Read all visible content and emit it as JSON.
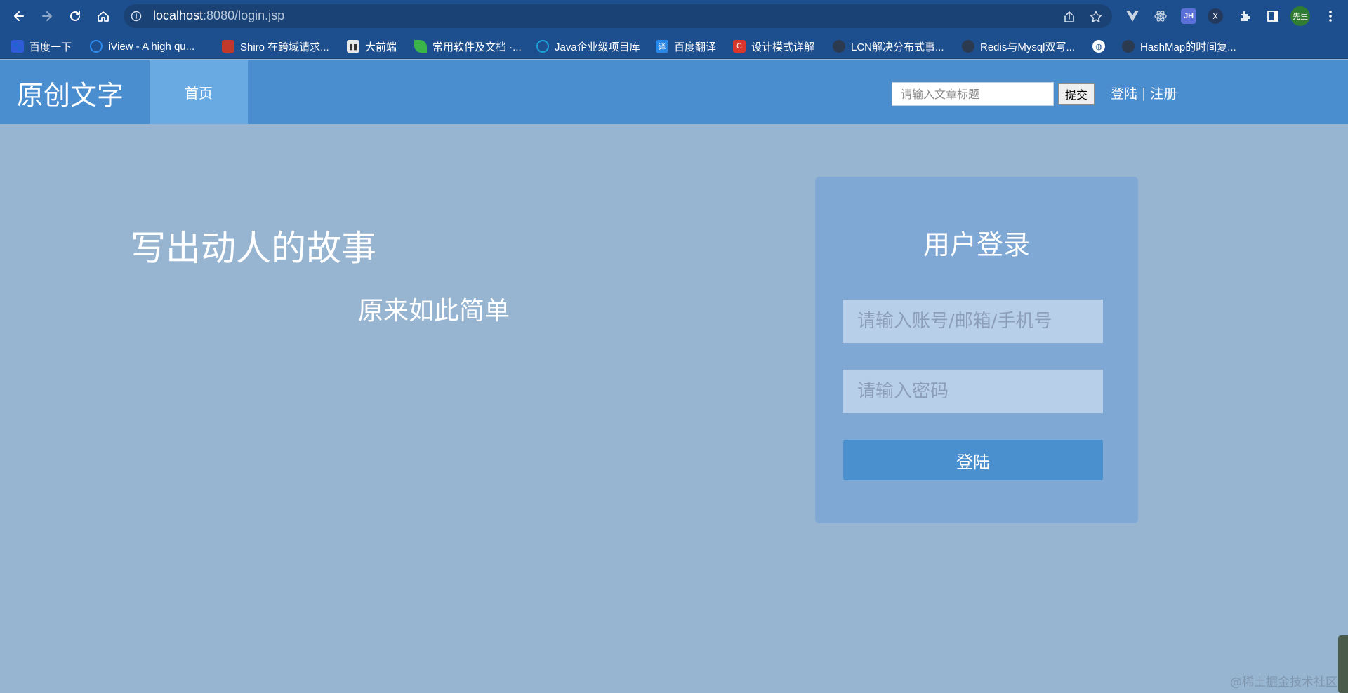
{
  "browser": {
    "url_host": "localhost",
    "url_rest": ":8080/login.jsp",
    "profile_label": "先生",
    "extension_jh_label": "JH",
    "extension_x_label": "X"
  },
  "bookmarks": [
    {
      "label": "百度一下",
      "icon": "baidu-icon",
      "color": "#2f5bd9"
    },
    {
      "label": "iView - A high qu...",
      "icon": "iview-icon",
      "color": "#2d8cf0"
    },
    {
      "label": "Shiro 在跨域请求...",
      "icon": "shiro-icon",
      "color": "#c0392b"
    },
    {
      "label": "大前端",
      "icon": "book-icon",
      "color": "#e8e8e8"
    },
    {
      "label": "常用软件及文档 ·...",
      "icon": "leaf-icon",
      "color": "#3ab54a"
    },
    {
      "label": "Java企业级项目库",
      "icon": "java-icon",
      "color": "#1aa3d8"
    },
    {
      "label": "百度翻译",
      "icon": "translate-icon",
      "color": "#2b87e6"
    },
    {
      "label": "设计模式详解",
      "icon": "csdn-icon",
      "color": "#d9372c"
    },
    {
      "label": "LCN解决分布式事...",
      "icon": "github-icon",
      "color": "#2b3a4e"
    },
    {
      "label": "Redis与Mysql双写...",
      "icon": "github-icon",
      "color": "#2b3a4e"
    },
    {
      "label": "",
      "icon": "globe-icon",
      "color": "#ffffff"
    },
    {
      "label": "HashMap的时间复...",
      "icon": "github-icon",
      "color": "#2b3a4e"
    }
  ],
  "header": {
    "brand": "原创文字",
    "nav_home": "首页",
    "search_placeholder": "请输入文章标题",
    "search_submit": "提交",
    "login_link": "登陆",
    "separator": "|",
    "register_link": "注册"
  },
  "hero": {
    "title": "写出动人的故事",
    "subtitle": "原来如此简单"
  },
  "login": {
    "title": "用户登录",
    "account_placeholder": "请输入账号/邮箱/手机号",
    "password_placeholder": "请输入密码",
    "submit_label": "登陆"
  },
  "watermark": "@稀土掘金技术社区",
  "colors": {
    "page_bg": "#97b5d1",
    "header_bg": "#4a8ed0",
    "nav_active_bg": "#6aaae2",
    "card_bg": "#7fa8d4",
    "field_bg": "#b8cfea",
    "button_bg": "#4a90cf",
    "browser_bg": "#1d4f8e"
  }
}
